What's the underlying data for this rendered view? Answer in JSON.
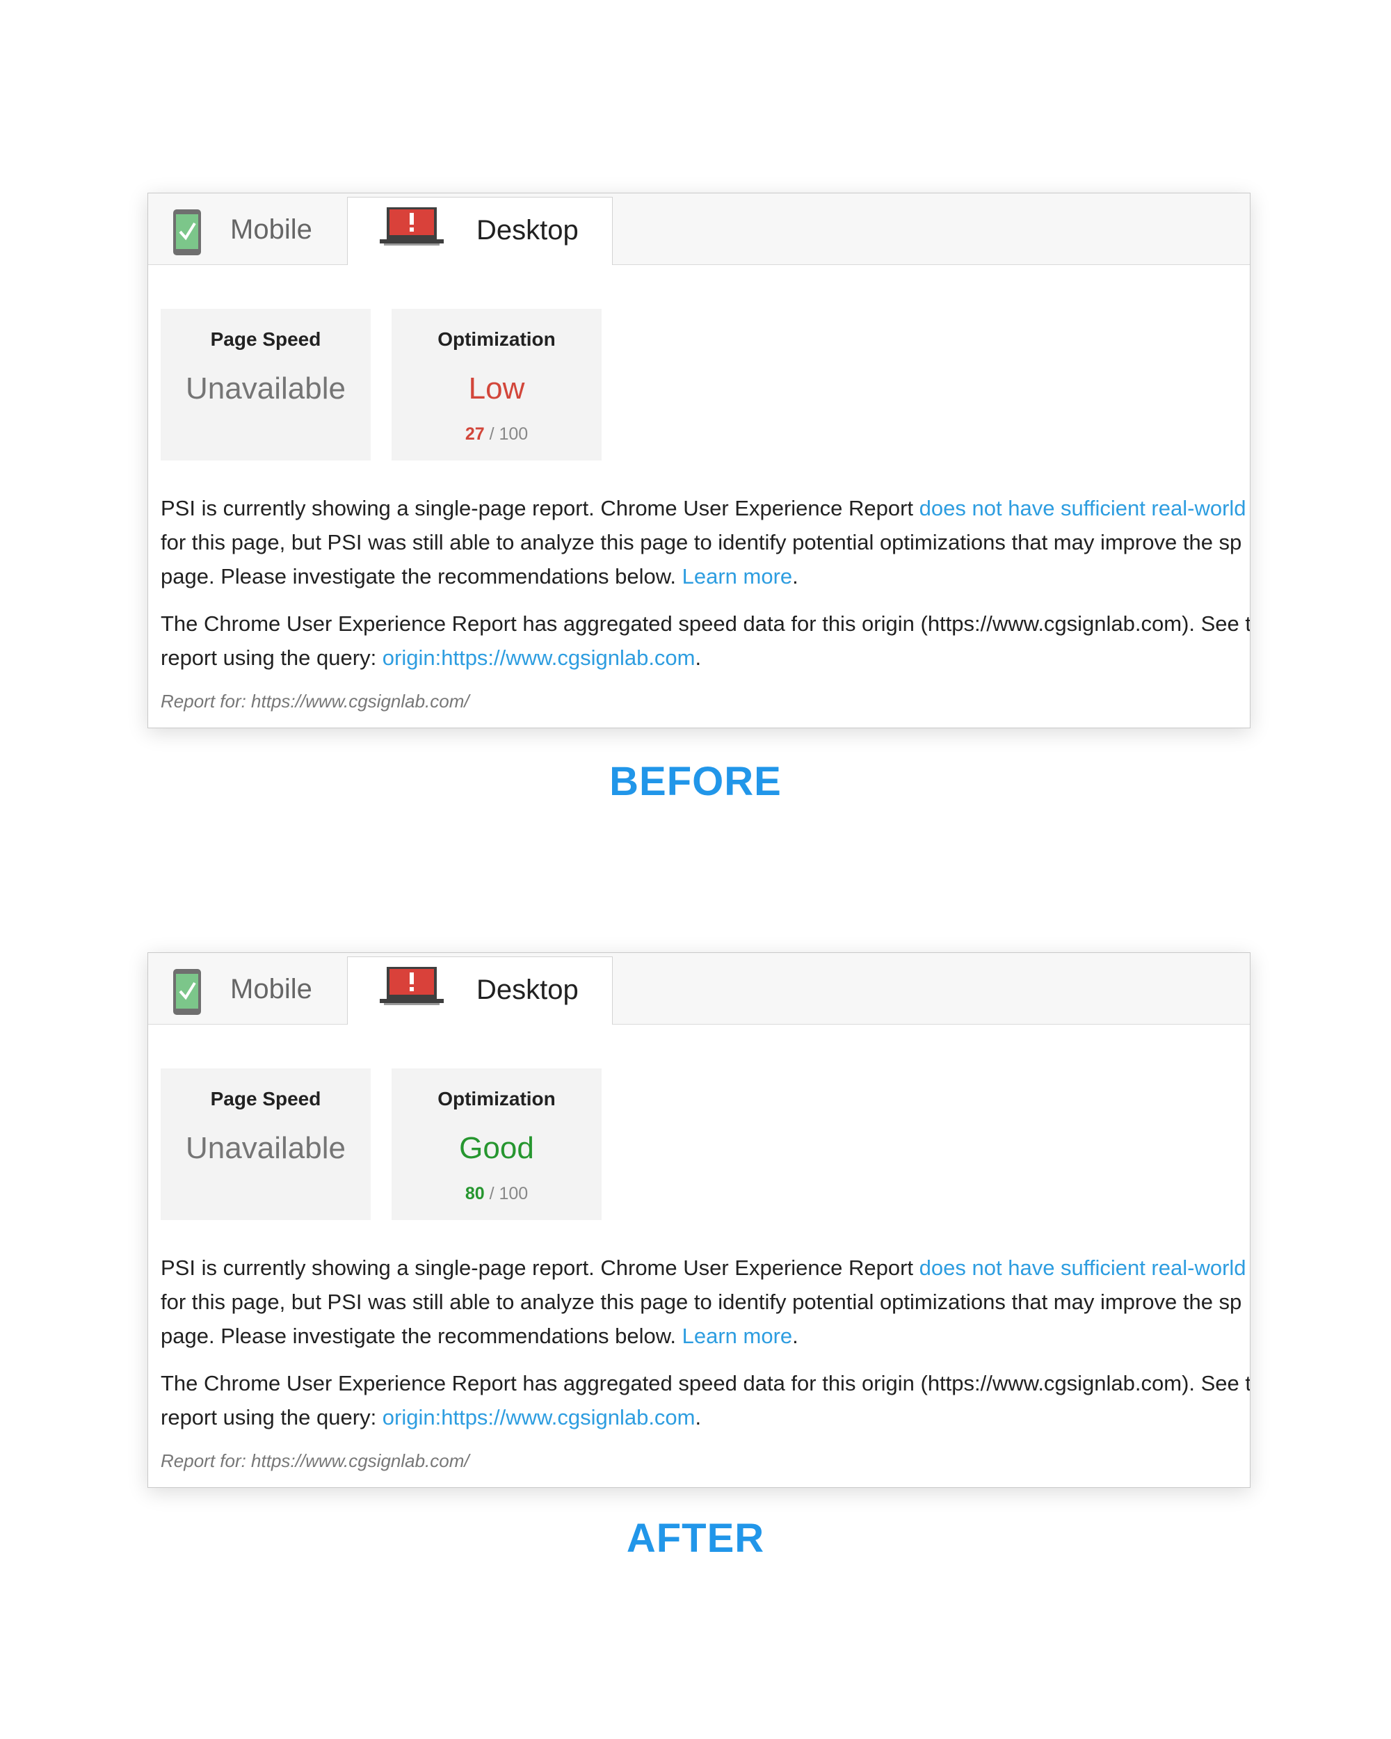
{
  "shared": {
    "tabs": {
      "mobile": "Mobile",
      "desktop": "Desktop"
    },
    "page_speed_title": "Page Speed",
    "page_speed_value": "Unavailable",
    "optimization_title": "Optimization",
    "score_max": "/ 100",
    "para1": {
      "text1": "PSI is currently showing a single-page report. Chrome User Experience Report ",
      "link1": "does not have sufficient real-world s",
      "line2": "for this page, but PSI was still able to analyze this page to identify potential optimizations that may improve the sp",
      "text3": "page. Please investigate the recommendations below. ",
      "link2": "Learn more",
      "end": "."
    },
    "para2": {
      "line1": "The Chrome User Experience Report has aggregated speed data for this origin (https://www.cgsignlab.com). See t",
      "text2": "report using the query: ",
      "link": "origin:https://www.cgsignlab.com",
      "end": "."
    },
    "report_for": "Report for: https://www.cgsignlab.com/"
  },
  "before": {
    "caption": "BEFORE",
    "optimization_value": "Low",
    "optimization_score": "27"
  },
  "after": {
    "caption": "AFTER",
    "optimization_value": "Good",
    "optimization_score": "80"
  },
  "colors": {
    "low": "#d2463a",
    "good": "#26962f",
    "link": "#2d9de0",
    "caption": "#2196e9"
  },
  "icons": {
    "mobile_tab": "phone-check-icon",
    "desktop_tab": "laptop-alert-icon"
  }
}
